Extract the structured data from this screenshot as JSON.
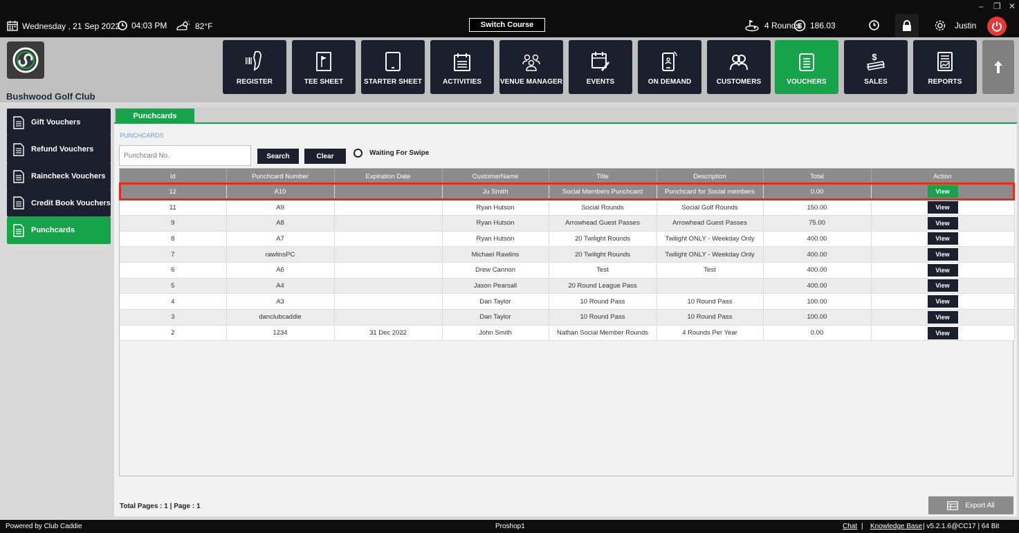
{
  "topbar": {
    "date": "Wednesday , 21 Sep 2022",
    "time": "04:03 PM",
    "weather": "82°F",
    "switch_course": "Switch Course",
    "rounds": "4 Rounds",
    "balance": "186.03",
    "user": "Justin",
    "minimize": "–",
    "restore": "❐",
    "close": "✕"
  },
  "header": {
    "club_name": "Bushwood Golf Club",
    "nav": [
      {
        "label": "REGISTER",
        "icon": "barcode-scanner-icon"
      },
      {
        "label": "TEE SHEET",
        "icon": "flag-icon"
      },
      {
        "label": "STARTER SHEET",
        "icon": "tablet-icon"
      },
      {
        "label": "ACTIVITIES",
        "icon": "calendar-list-icon"
      },
      {
        "label": "VENUE MANAGER",
        "icon": "group-icon"
      },
      {
        "label": "EVENTS",
        "icon": "calendar-edit-icon"
      },
      {
        "label": "ON DEMAND",
        "icon": "mobile-signal-icon"
      },
      {
        "label": "CUSTOMERS",
        "icon": "people-icon"
      },
      {
        "label": "VOUCHERS",
        "icon": "voucher-icon"
      },
      {
        "label": "SALES",
        "icon": "money-icon"
      },
      {
        "label": "REPORTS",
        "icon": "report-icon"
      }
    ],
    "active_nav": "VOUCHERS"
  },
  "sidebar": {
    "items": [
      {
        "label": "Gift Vouchers"
      },
      {
        "label": "Refund Vouchers"
      },
      {
        "label": "Raincheck Vouchers"
      },
      {
        "label": "Credit Book Vouchers"
      },
      {
        "label": "Punchcards"
      }
    ],
    "active": "Punchcards"
  },
  "main": {
    "tab": "Punchcards",
    "section_label": "PUNCHCARDS",
    "search": {
      "placeholder": "Punchcard No.",
      "value": ""
    },
    "search_button": "Search",
    "clear_button": "Clear",
    "waiting_for_swipe": "Waiting For Swipe",
    "columns": [
      "Id",
      "Punchcard Number",
      "Expiration Date",
      "CustomerName",
      "Title",
      "Description",
      "Total",
      "Action"
    ],
    "rows": [
      {
        "id": "12",
        "number": "A10",
        "expiration": "",
        "customer": "Ju Smith",
        "title": "Social Members Punchcard",
        "description": "Punchcard for Social members",
        "total": "0.00",
        "action": "View",
        "selected": true
      },
      {
        "id": "11",
        "number": "A9",
        "expiration": "",
        "customer": "Ryan Hutson",
        "title": "Social Rounds",
        "description": "Social Golf Rounds",
        "total": "150.00",
        "action": "View"
      },
      {
        "id": "9",
        "number": "A8",
        "expiration": "",
        "customer": "Ryan Hutson",
        "title": "Arrowhead Guest Passes",
        "description": "Arrowhead Guest Passes",
        "total": "75.00",
        "action": "View"
      },
      {
        "id": "8",
        "number": "A7",
        "expiration": "",
        "customer": "Ryan Hutson",
        "title": "20 Twilight Rounds",
        "description": "Twilight ONLY - Weekday Only",
        "total": "400.00",
        "action": "View"
      },
      {
        "id": "7",
        "number": "rawlinsPC",
        "expiration": "",
        "customer": "Michael Rawlins",
        "title": "20 Twilight Rounds",
        "description": "Twilight ONLY - Weekday Only",
        "total": "400.00",
        "action": "View"
      },
      {
        "id": "6",
        "number": "A6",
        "expiration": "",
        "customer": "Drew Cannon",
        "title": "Test",
        "description": "Test",
        "total": "400.00",
        "action": "View"
      },
      {
        "id": "5",
        "number": "A4",
        "expiration": "",
        "customer": "Jason Pearsall",
        "title": "20 Round League Pass",
        "description": "",
        "total": "400.00",
        "action": "View"
      },
      {
        "id": "4",
        "number": "A3",
        "expiration": "",
        "customer": "Dan Taylor",
        "title": "10 Round Pass",
        "description": "10 Round Pass",
        "total": "100.00",
        "action": "View"
      },
      {
        "id": "3",
        "number": "danclubcaddie",
        "expiration": "",
        "customer": "Dan Taylor",
        "title": "10 Round Pass",
        "description": "10 Round Pass",
        "total": "100.00",
        "action": "View"
      },
      {
        "id": "2",
        "number": "1234",
        "expiration": "31 Dec 2022",
        "customer": "John Smith",
        "title": "Nathan Social Member Rounds",
        "description": "4 Rounds Per Year",
        "total": "0.00",
        "action": "View"
      }
    ],
    "pages": "Total Pages : 1 | Page : 1",
    "export_button": "Export All"
  },
  "footer": {
    "powered_by": "Powered by Club Caddie",
    "station": "Proshop1",
    "chat": "Chat",
    "sep1": "|",
    "knowledge_base": "Knowledge Base",
    "version": "|  v5.2.1.6@CC17  |  64 Bit"
  },
  "colors": {
    "accent_green": "#16a34a",
    "nav_dark": "#1b1f2e",
    "highlight_red": "#e32b1e",
    "power_red": "#e53935"
  }
}
